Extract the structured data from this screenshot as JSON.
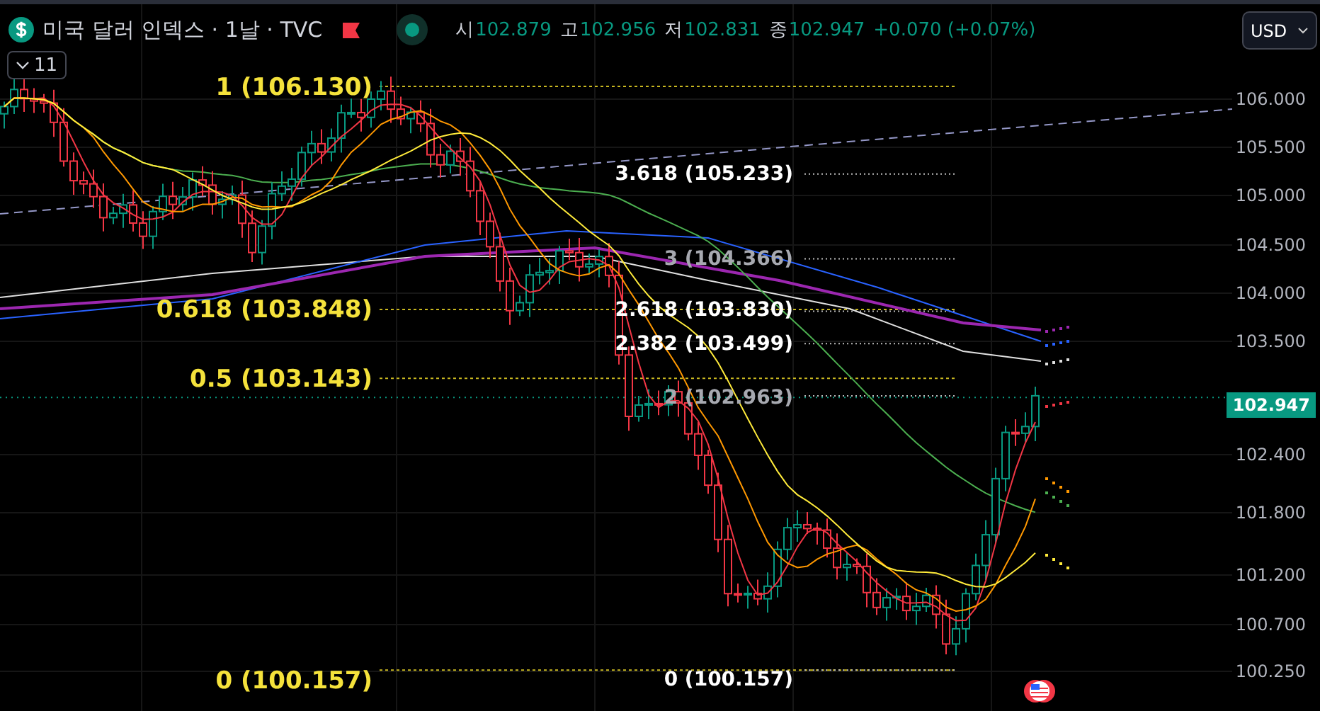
{
  "header": {
    "title": "미국 달러 인덱스 · 1날 · TVC",
    "market_open": true,
    "ohlc": [
      {
        "label": "시",
        "value": "102.879"
      },
      {
        "label": "고",
        "value": "102.956"
      },
      {
        "label": "저",
        "value": "102.831"
      },
      {
        "label": "종",
        "value": "102.947"
      }
    ],
    "change": "+0.070 (+0.07%)"
  },
  "indicators_toggle": {
    "count": "11",
    "expanded": false
  },
  "currency_select": {
    "value": "USD"
  },
  "price_axis": {
    "labels": [
      "106.000",
      "105.500",
      "105.000",
      "104.500",
      "104.000",
      "103.500",
      "102.400",
      "101.800",
      "101.200",
      "100.700",
      "100.250"
    ],
    "last_price": "102.947"
  },
  "fib_retracement": [
    {
      "label": "1 (106.130)"
    },
    {
      "label": "0.618 (103.848)"
    },
    {
      "label": "0.5 (103.143)"
    },
    {
      "label": "0 (100.157)"
    }
  ],
  "fib_extension": [
    {
      "label": "3.618 (105.233)"
    },
    {
      "label": "3 (104.366)"
    },
    {
      "label": "2.618 (103.830)"
    },
    {
      "label": "2.382 (103.499)"
    },
    {
      "label": "2 (102.963)"
    },
    {
      "label": "0 (100.157)"
    }
  ]
}
